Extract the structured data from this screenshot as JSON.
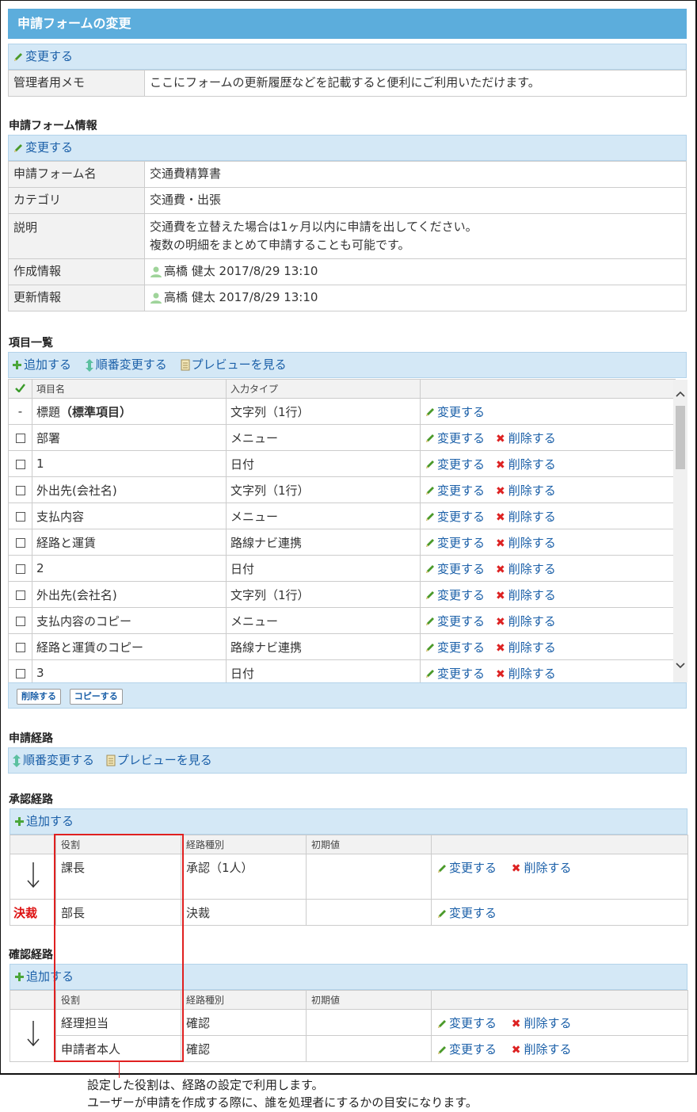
{
  "page": {
    "title": "申請フォームの変更"
  },
  "memo_section": {
    "change_label": "変更する",
    "rows": [
      {
        "key": "管理者用メモ",
        "value": "ここにフォームの更新履歴などを記載すると便利にご利用いただけます。"
      }
    ]
  },
  "form_info": {
    "heading": "申請フォーム情報",
    "change_label": "変更する",
    "name_key": "申請フォーム名",
    "name_value": "交通費精算書",
    "category_key": "カテゴリ",
    "category_value": "交通費・出張",
    "desc_key": "説明",
    "desc_line1": "交通費を立替えた場合は1ヶ月以内に申請を出してください。",
    "desc_line2": "複数の明細をまとめて申請することも可能です。",
    "created_key": "作成情報",
    "created_value": "高橋 健太 2017/8/29 13:10",
    "updated_key": "更新情報",
    "updated_value": "高橋 健太 2017/8/29 13:10"
  },
  "items": {
    "heading": "項目一覧",
    "toolbar": {
      "add": "追加する",
      "reorder": "順番変更する",
      "preview": "プレビューを見る"
    },
    "columns": {
      "name": "項目名",
      "type": "入力タイプ"
    },
    "change_label": "変更する",
    "delete_label": "削除する",
    "first_row": {
      "mark": "-",
      "name": "標題",
      "suffix": "（標準項目）",
      "type": "文字列（1行）"
    },
    "rows": [
      {
        "name": "部署",
        "type": "メニュー"
      },
      {
        "name": "1",
        "type": "日付"
      },
      {
        "name": "外出先(会社名)",
        "type": "文字列（1行）"
      },
      {
        "name": "支払内容",
        "type": "メニュー"
      },
      {
        "name": "経路と運賃",
        "type": "路線ナビ連携"
      },
      {
        "name": "2",
        "type": "日付"
      },
      {
        "name": "外出先(会社名)",
        "type": "文字列（1行）"
      },
      {
        "name": "支払内容のコピー",
        "type": "メニュー"
      },
      {
        "name": "経路と運賃のコピー",
        "type": "路線ナビ連携"
      },
      {
        "name": "3",
        "type": "日付"
      }
    ],
    "footer_buttons": {
      "delete": "削除する",
      "copy": "コピーする"
    }
  },
  "route": {
    "heading": "申請経路",
    "toolbar": {
      "reorder": "順番変更する",
      "preview": "プレビューを見る"
    }
  },
  "approval": {
    "heading": "承認経路",
    "add_label": "追加する",
    "columns": {
      "role": "役割",
      "kind": "経路種別",
      "initial": "初期値"
    },
    "rows": [
      {
        "role": "課長",
        "kind": "承認（1人）",
        "initial": "",
        "change": "変更する",
        "delete": "削除する"
      },
      {
        "role": "部長",
        "kind": "決裁",
        "initial": "",
        "change": "変更する"
      }
    ],
    "kessai_mark": "決裁"
  },
  "confirm": {
    "heading": "確認経路",
    "add_label": "追加する",
    "columns": {
      "role": "役割",
      "kind": "経路種別",
      "initial": "初期値"
    },
    "rows": [
      {
        "role": "経理担当",
        "kind": "確認",
        "initial": "",
        "change": "変更する",
        "delete": "削除する"
      },
      {
        "role": "申請者本人",
        "kind": "確認",
        "initial": "",
        "change": "変更する",
        "delete": "削除する"
      }
    ]
  },
  "annotation": {
    "line1": "設定した役割は、経路の設定で利用します。",
    "line2": "ユーザーが申請を作成する際に、誰を処理者にするかの目安になります。"
  },
  "colors": {
    "title_bar": "#5caddc",
    "toolbar": "#d4e8f6",
    "link": "#1a5fa8",
    "delete_x": "#dd2222",
    "highlight": "#e02020"
  }
}
